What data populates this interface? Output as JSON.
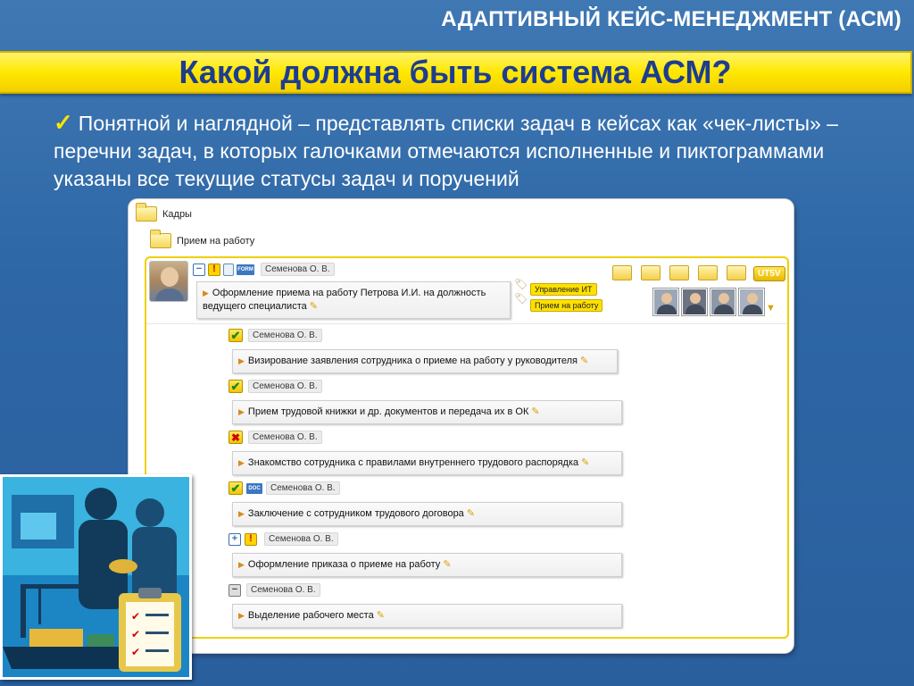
{
  "slide": {
    "header": "АДАПТИВНЫЙ КЕЙС-МЕНЕДЖМЕНТ (АСМ)",
    "title": "Какой должна быть система АСМ?",
    "bullet": "Понятной и наглядной – представлять списки задач в кейсах как «чек-листы» – перечни задач, в которых галочками отмечаются исполненные и пиктограммами указаны все текущие статусы задач и поручений"
  },
  "colors": {
    "background": "#2e67a6",
    "title_bar": "#ffe800",
    "title_text": "#1d3d8f",
    "check_mark": "#ffe400"
  },
  "tree": {
    "root": "Кадры",
    "child": "Прием на работу"
  },
  "case": {
    "icons": [
      "minus-icon",
      "warning-icon",
      "document-icon",
      "form-icon"
    ],
    "form_label": "FORM",
    "assignee": "Семенова О. В.",
    "title": "Оформление приема на работу Петрова И.И. на должность ведущего специалиста",
    "tags": [
      "Управление ИТ",
      "Прием на работу"
    ],
    "status_badge": "UT5V"
  },
  "tasks": [
    {
      "status": "done",
      "status_symbol": "✔",
      "assignee": "Семенова О. В.",
      "text": "Визирование заявления сотрудника о приеме на работу у руководителя"
    },
    {
      "status": "done",
      "status_symbol": "✔",
      "assignee": "Семенова О. В.",
      "text": "Прием трудовой книжки и др. документов и передача их в ОК"
    },
    {
      "status": "rejected",
      "status_symbol": "✖",
      "assignee": "Семенова О. В.",
      "text": "Знакомство сотрудника с правилами внутреннего трудового распорядка"
    },
    {
      "status": "done",
      "status_symbol": "✔",
      "extra_label": "DOC",
      "assignee": "Семенова О. В.",
      "text": "Заключение с сотрудником трудового договора"
    },
    {
      "status": "expandable",
      "status_symbol": "+",
      "extra_label": "!",
      "assignee": "Семенова О. В.",
      "text": "Оформление приказа о приеме на работу"
    },
    {
      "status": "pending",
      "status_symbol": "−",
      "assignee": "Семенова О. В.",
      "text": "Выделение рабочего места"
    }
  ]
}
